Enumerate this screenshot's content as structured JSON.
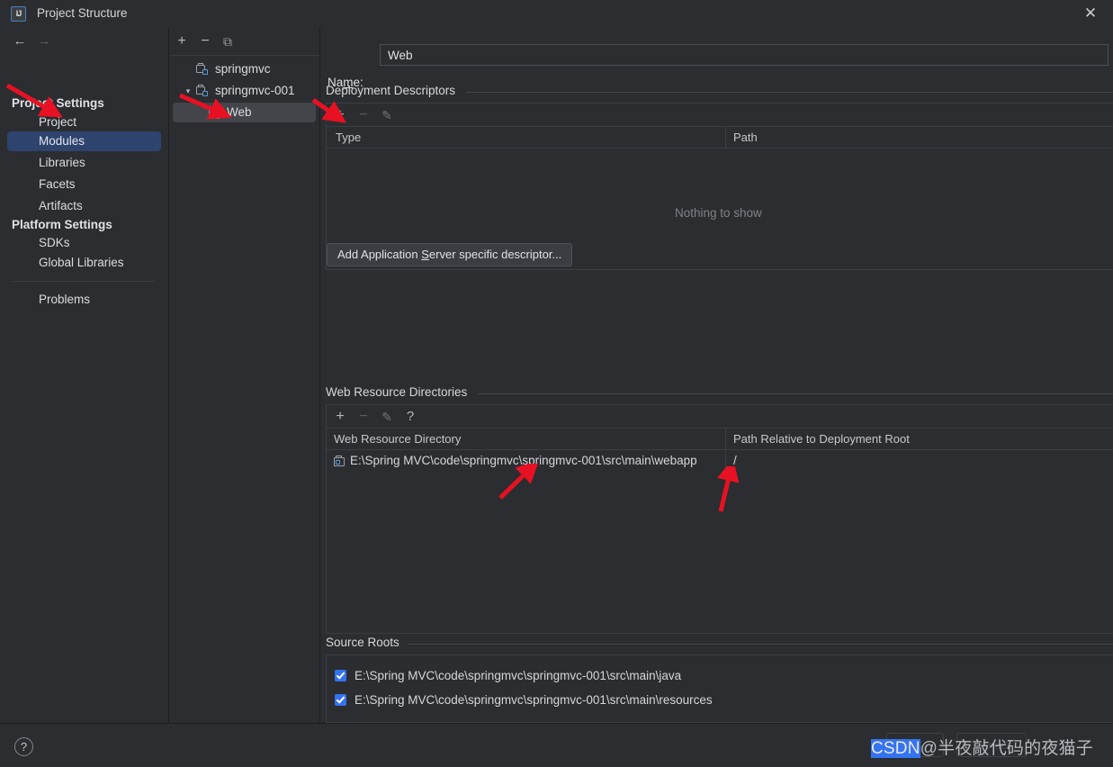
{
  "window": {
    "title": "Project Structure",
    "app_icon": "intellij-idea-icon",
    "close_label": "✕"
  },
  "sidebar": {
    "nav": {
      "back": "←",
      "forward": "→"
    },
    "groups": [
      {
        "label": "Project Settings",
        "items": [
          "Project",
          "Modules",
          "Libraries",
          "Facets",
          "Artifacts"
        ]
      },
      {
        "label": "Platform Settings",
        "items": [
          "SDKs",
          "Global Libraries"
        ]
      }
    ],
    "selected": "Modules",
    "problems_label": "Problems"
  },
  "tree": {
    "toolbar": {
      "add": "+",
      "remove": "−",
      "copy": "⧉"
    },
    "nodes": [
      {
        "label": "springmvc",
        "icon": "module-icon",
        "indent": 0,
        "expanded": null,
        "selected": false
      },
      {
        "label": "springmvc-001",
        "icon": "module-icon",
        "indent": 0,
        "expanded": true,
        "selected": false
      },
      {
        "label": "Web",
        "icon": "web-facet-icon",
        "indent": 1,
        "expanded": null,
        "selected": true
      }
    ]
  },
  "main": {
    "name_label_pre": "Na",
    "name_label_mnemonic": "m",
    "name_label_post": "e:",
    "name_value": "Web",
    "deployment": {
      "header": "Deployment Descriptors",
      "toolbar": {
        "add": "+",
        "remove": "−",
        "edit": "✎"
      },
      "columns": [
        "Type",
        "Path"
      ],
      "rows": [],
      "empty_text": "Nothing to show",
      "button_pre": "Add Application ",
      "button_mnemonic": "S",
      "button_post": "erver specific descriptor..."
    },
    "web_resources": {
      "header": "Web Resource Directories",
      "toolbar": {
        "add": "+",
        "remove": "−",
        "edit": "✎",
        "help": "?"
      },
      "columns": [
        "Web Resource Directory",
        "Path Relative to Deployment Root"
      ],
      "rows": [
        {
          "directory": "E:\\Spring MVC\\code\\springmvc\\springmvc-001\\src\\main\\webapp",
          "relative_path": "/"
        }
      ]
    },
    "source_roots": {
      "header": "Source Roots",
      "rows": [
        {
          "path": "E:\\Spring MVC\\code\\springmvc\\springmvc-001\\src\\main\\java",
          "checked": true
        },
        {
          "path": "E:\\Spring MVC\\code\\springmvc\\springmvc-001\\src\\main\\resources",
          "checked": true
        }
      ]
    }
  },
  "footer": {
    "help": "?",
    "ok_label": "OK",
    "cancel_label": "Cancel",
    "watermark_highlight": "CSDN",
    "watermark_rest": "@半夜敲代码的夜猫子"
  },
  "annotations": {
    "color": "#e81123",
    "arrows": [
      "points-to-modules",
      "points-to-web-node",
      "points-to-deployment-add",
      "points-to-web-resource-directory",
      "points-to-relative-path"
    ]
  }
}
